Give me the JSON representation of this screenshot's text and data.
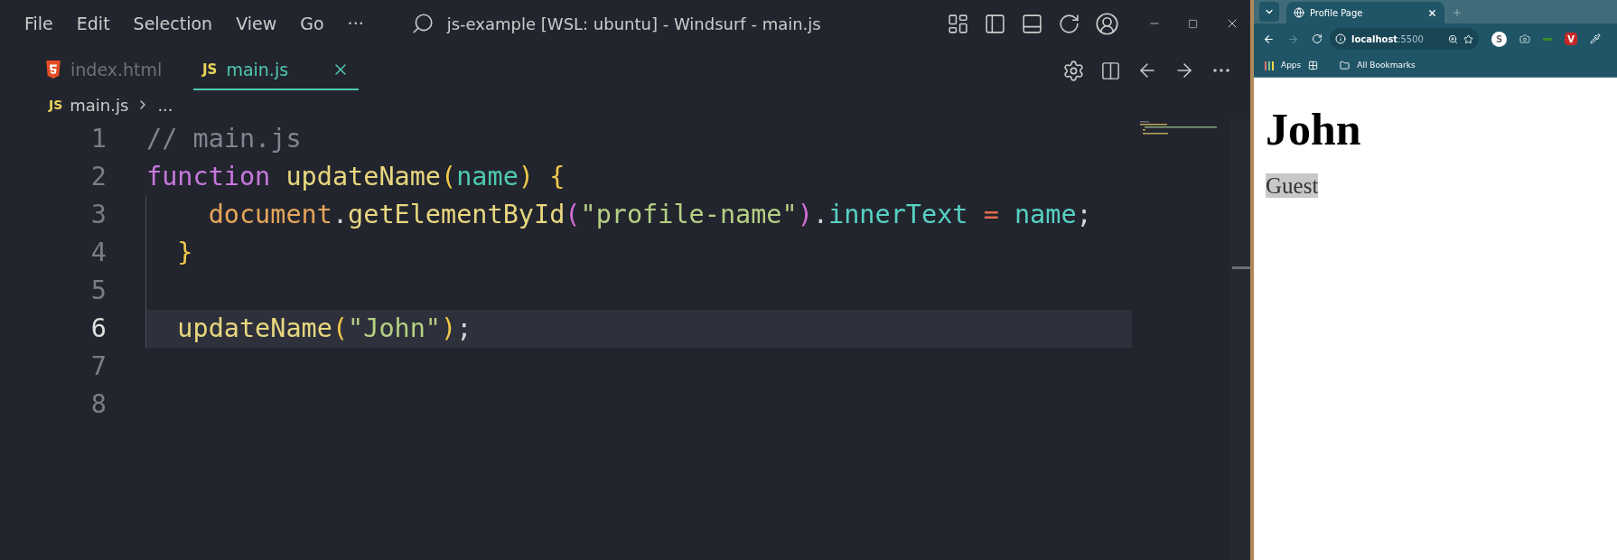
{
  "window": {
    "title": "js-example [WSL: ubuntu] - Windsurf - main.js"
  },
  "menu": [
    "File",
    "Edit",
    "Selection",
    "View",
    "Go",
    "···"
  ],
  "tabs": [
    {
      "kind": "html",
      "label": "index.html",
      "selected": false
    },
    {
      "kind": "js",
      "badge": "JS",
      "label": "main.js",
      "selected": true
    }
  ],
  "breadcrumb": {
    "badge": "JS",
    "file": "main.js",
    "more": "..."
  },
  "editor": {
    "lines": [
      {
        "number": "1",
        "active": false,
        "tokens": [
          {
            "text": "// main.js",
            "kind": "comment"
          }
        ]
      },
      {
        "number": "2",
        "active": false,
        "tokens": [
          {
            "text": "function",
            "kind": "keyword"
          },
          {
            "text": " updateName",
            "kind": "function"
          },
          {
            "text": "(",
            "kind": "paren"
          },
          {
            "text": "name",
            "kind": "param"
          },
          {
            "text": ")",
            "kind": "paren"
          },
          {
            "text": " {",
            "kind": "paren"
          }
        ]
      },
      {
        "number": "3",
        "active": false,
        "tokens": [
          {
            "text": "    document",
            "kind": "variable"
          },
          {
            "text": ".",
            "kind": "punct"
          },
          {
            "text": "getElementById",
            "kind": "function"
          },
          {
            "text": "(",
            "kind": "paren2"
          },
          {
            "text": "\"profile-name\"",
            "kind": "string"
          },
          {
            "text": ")",
            "kind": "paren2"
          },
          {
            "text": ".",
            "kind": "punct"
          },
          {
            "text": "innerText",
            "kind": "property"
          },
          {
            "text": " =",
            "kind": "operator"
          },
          {
            "text": " name",
            "kind": "property"
          },
          {
            "text": ";",
            "kind": "punct"
          }
        ]
      },
      {
        "number": "4",
        "active": false,
        "tokens": [
          {
            "text": "  }",
            "kind": "paren"
          }
        ]
      },
      {
        "number": "5",
        "active": false
      },
      {
        "number": "6",
        "active": true,
        "tokens": [
          {
            "text": "  updateName",
            "kind": "function"
          },
          {
            "text": "(",
            "kind": "paren"
          },
          {
            "text": "\"John\"",
            "kind": "string"
          },
          {
            "text": ")",
            "kind": "paren"
          },
          {
            "text": ";",
            "kind": "punct"
          }
        ]
      },
      {
        "number": "7",
        "active": false
      },
      {
        "number": "8",
        "active": false
      }
    ]
  },
  "browser": {
    "tab": {
      "title": "Profile Page"
    },
    "address": {
      "host": "localhost",
      "port": ":5500"
    },
    "profile_initial": "S",
    "extension_badge": "V",
    "bookmarks": [
      "Apps",
      "All Bookmarks"
    ],
    "page": {
      "heading": "John",
      "text": "Guest"
    }
  }
}
